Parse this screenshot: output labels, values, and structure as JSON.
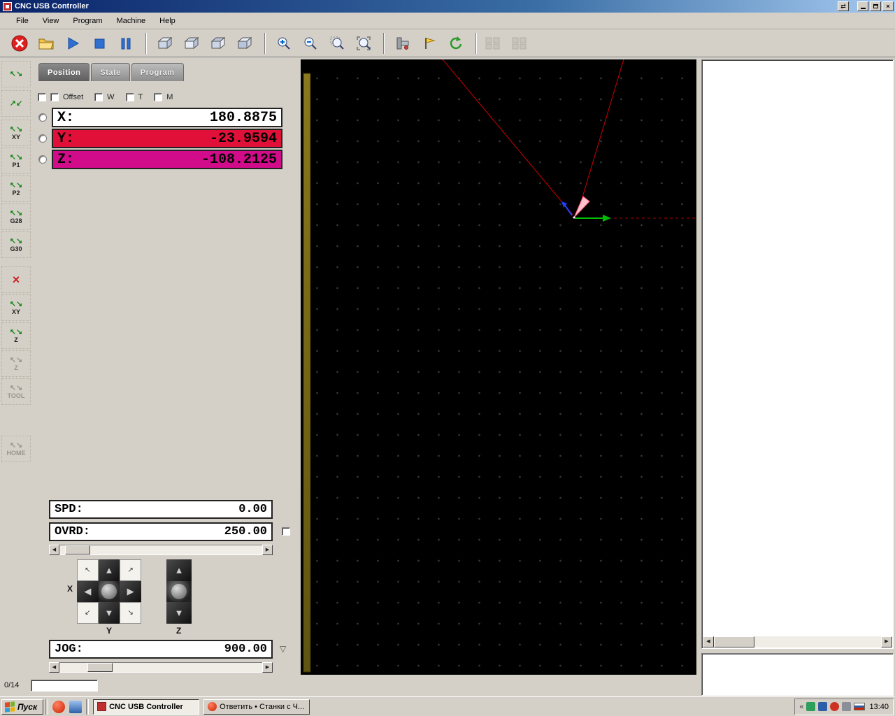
{
  "window": {
    "title": "CNC USB Controller"
  },
  "menu": {
    "items": [
      "File",
      "View",
      "Program",
      "Machine",
      "Help"
    ]
  },
  "toolbar": {
    "buttons": [
      "emergency-stop",
      "open-file",
      "run-program",
      "stop-program",
      "pause-program",
      "view-isometric",
      "view-top",
      "view-front",
      "view-side",
      "zoom-in",
      "zoom-out",
      "zoom-window",
      "zoom-extents",
      "machine-control",
      "measure-probe",
      "refresh-view",
      "offset-pad-disabled-1",
      "offset-pad-disabled-2"
    ]
  },
  "sidebar": {
    "items": [
      {
        "name": "jog-to-zero",
        "label": ""
      },
      {
        "name": "jog-to-position",
        "label": ""
      },
      {
        "name": "goto-xy",
        "label": "XY"
      },
      {
        "name": "goto-p1",
        "label": "P1"
      },
      {
        "name": "goto-p2",
        "label": "P2"
      },
      {
        "name": "goto-g28",
        "label": "G28"
      },
      {
        "name": "goto-g30",
        "label": "G30"
      },
      {
        "name": "cancel",
        "label": ""
      },
      {
        "name": "zero-xy",
        "label": "XY"
      },
      {
        "name": "zero-z",
        "label": "Z"
      },
      {
        "name": "probe-z",
        "label": "Z"
      },
      {
        "name": "tool",
        "label": "TOOL"
      },
      {
        "name": "home",
        "label": "HOME"
      }
    ]
  },
  "panel": {
    "tabs": [
      {
        "label": "Position",
        "active": true
      },
      {
        "label": "State",
        "active": false
      },
      {
        "label": "Program",
        "active": false
      }
    ],
    "offset_row": {
      "offset": "Offset",
      "w": "W",
      "t": "T",
      "m": "M"
    },
    "axes": [
      {
        "label": "X:",
        "value": "180.8875",
        "bg": "#ffffff"
      },
      {
        "label": "Y:",
        "value": "-23.9594",
        "bg": "#e01038"
      },
      {
        "label": "Z:",
        "value": "-108.2125",
        "bg": "#d10b8a"
      }
    ],
    "spd": {
      "label": "SPD:",
      "value": "0.00"
    },
    "ovrd": {
      "label": "OVRD:",
      "value": "250.00"
    },
    "jog": {
      "label": "JOG:",
      "value": "900.00"
    },
    "pad": {
      "x": "X",
      "y": "Y",
      "z": "Z"
    }
  },
  "status": {
    "progress": "0/14"
  },
  "taskbar": {
    "start": "Пуск",
    "tasks": [
      {
        "label": "CNC USB Controller"
      },
      {
        "label": "Ответить • Станки с Ч..."
      }
    ],
    "clock": "13:40"
  },
  "colors": {
    "titlebar": "#0a246a",
    "axis_y_bg": "#e01038",
    "axis_z_bg": "#d10b8a",
    "view_background": "#000000",
    "toolpath_red": "#cc0000",
    "axis_arrow_green": "#00bb00"
  }
}
